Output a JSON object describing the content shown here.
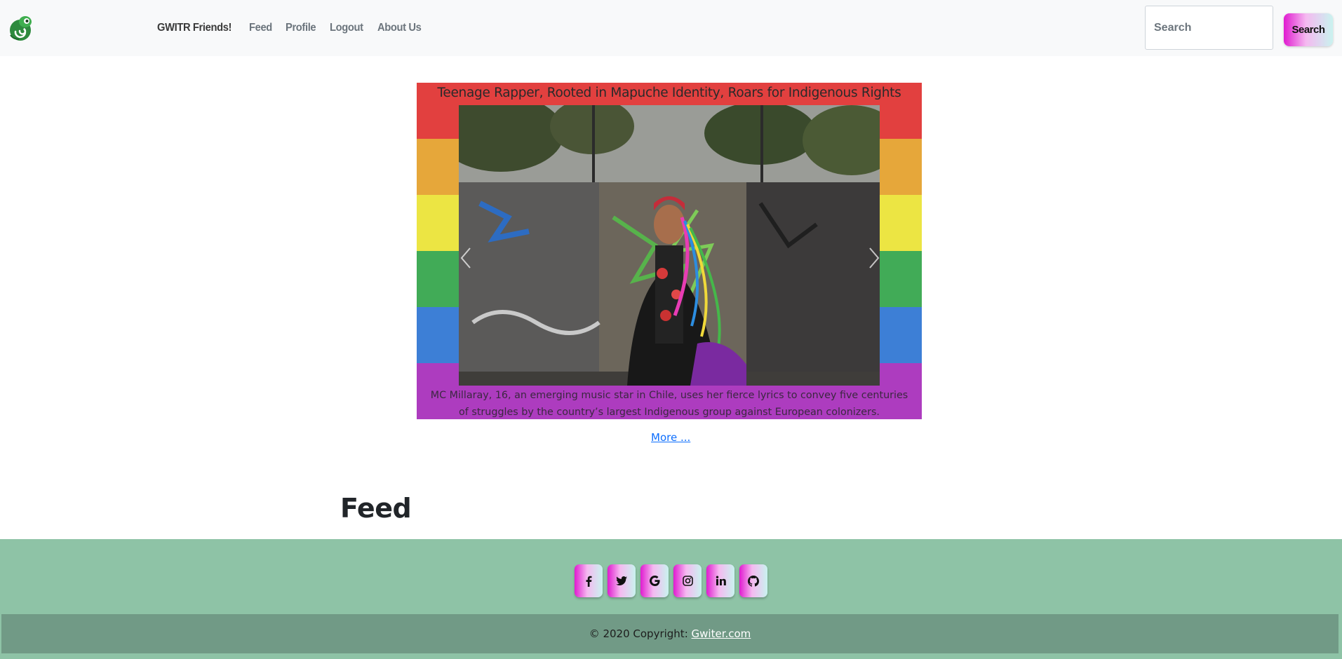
{
  "navbar": {
    "logo_icon": "chameleon-logo-icon",
    "links": [
      {
        "label": "GWITR Friends!"
      },
      {
        "label": "Feed"
      },
      {
        "label": "Profile"
      },
      {
        "label": "Logout"
      },
      {
        "label": "About Us"
      }
    ],
    "search": {
      "placeholder": "Search",
      "button_label": "Search"
    }
  },
  "carousel": {
    "title": "Teenage Rapper, Rooted in Mapuche Identity, Roars for Indigenous Rights",
    "caption": "MC Millaray, 16, an emerging music star in Chile, uses her fierce lyrics to convey five centuries of struggles by the country’s largest Indigenous group against European colonizers.",
    "stripe_colors": [
      "#e2403f",
      "#e6a73a",
      "#ece543",
      "#41ab57",
      "#3d7fd6",
      "#ad3cbf"
    ],
    "prev_icon": "chevron-left-icon",
    "next_icon": "chevron-right-icon",
    "more_link": "More ..."
  },
  "feed": {
    "heading": "Feed"
  },
  "footer": {
    "social": [
      {
        "name": "facebook-icon"
      },
      {
        "name": "twitter-icon"
      },
      {
        "name": "google-icon"
      },
      {
        "name": "instagram-icon"
      },
      {
        "name": "linkedin-icon"
      },
      {
        "name": "github-icon"
      }
    ],
    "copyright_prefix": "© 2020 Copyright:",
    "copyright_link": "Gwiter.com",
    "background": "#8ec3a6",
    "bar_background": "#719a86"
  },
  "theme": {
    "button_gradient": [
      "#e01bd0",
      "#f5b9f0",
      "#c9f3ef"
    ],
    "link_color": "#0d6efd"
  }
}
